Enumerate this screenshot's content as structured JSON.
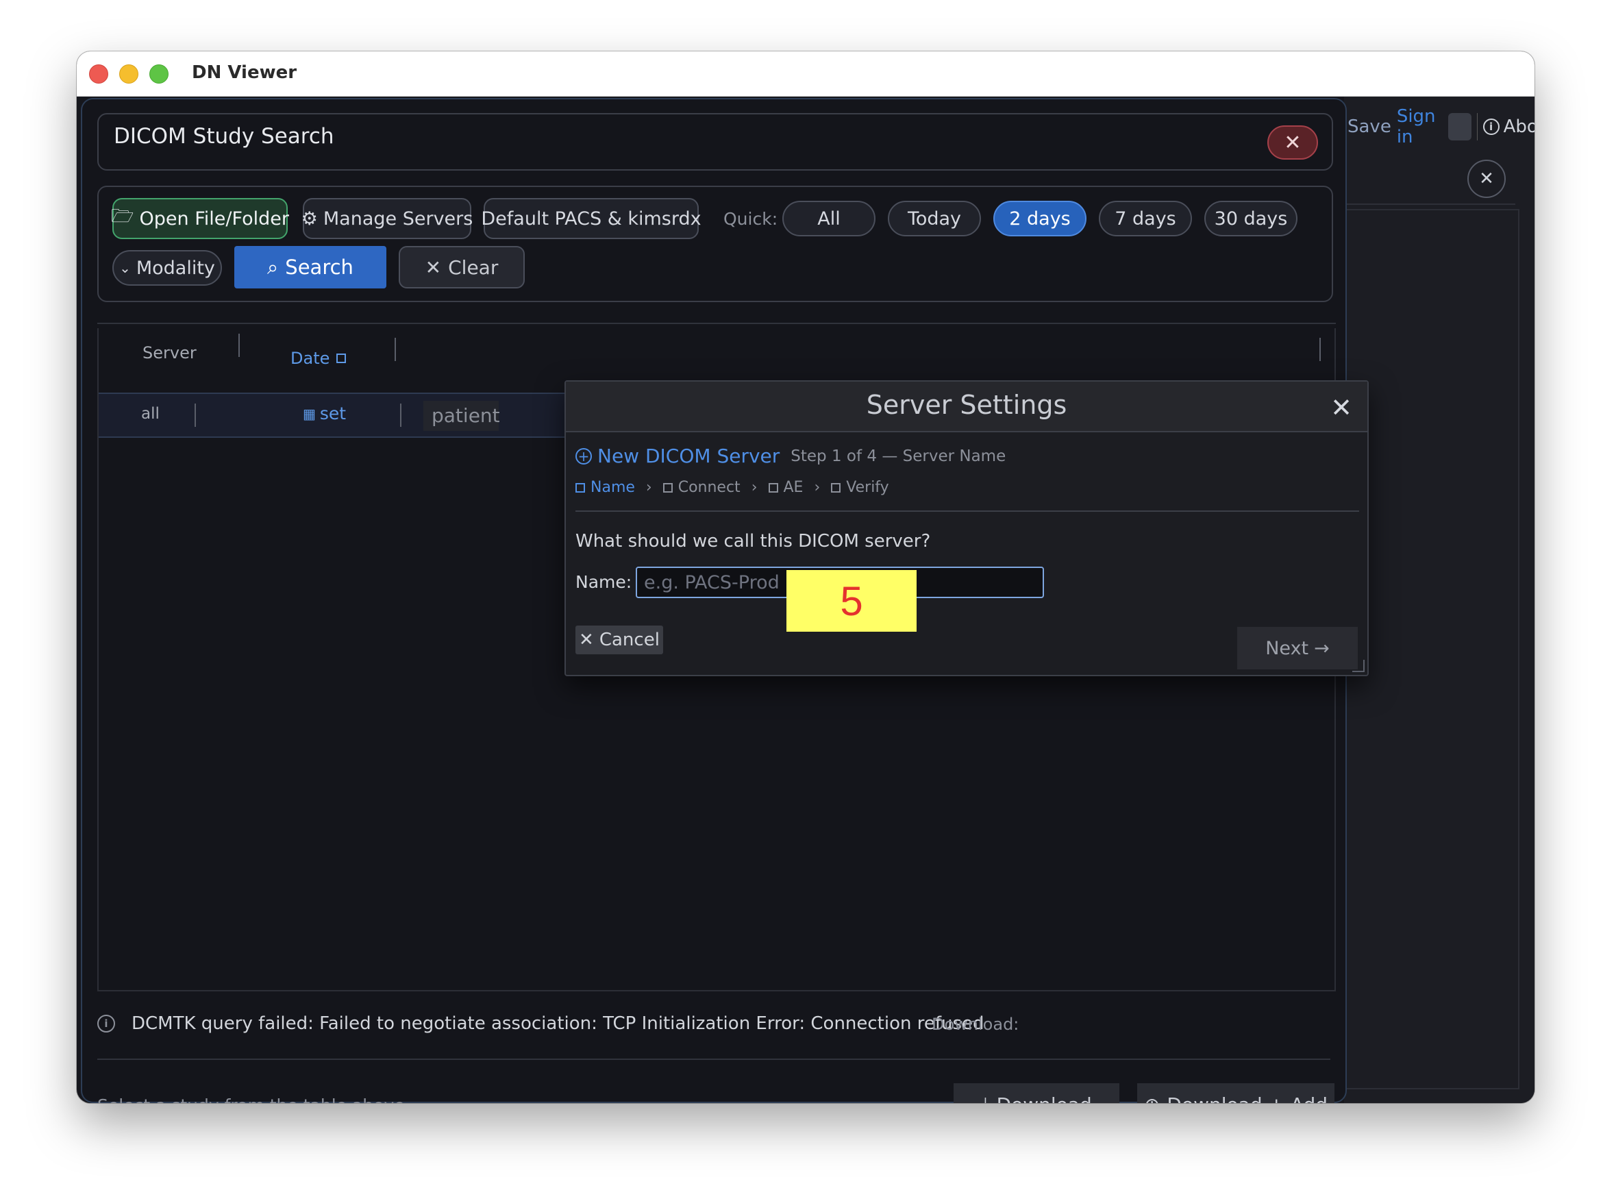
{
  "window": {
    "title": "DN Viewer"
  },
  "background": {
    "save_label": "Save",
    "signin_label": "Sign in",
    "about_label": "About"
  },
  "header": {
    "title": "DICOM Study Search"
  },
  "toolbar": {
    "open_label": "Open File/Folder",
    "manage_label": "Manage Servers",
    "server_selected": "Default PACS & kimsrdx",
    "quick_label": "Quick:",
    "quick_options": [
      "All",
      "Today",
      "2 days",
      "7 days",
      "30 days"
    ],
    "quick_selected": "2 days",
    "modality_label": "Modality",
    "search_label": "Search",
    "clear_label": "Clear"
  },
  "table": {
    "headers": [
      "Server",
      "Date"
    ],
    "filter": {
      "server": "all",
      "date": "set",
      "patient_placeholder": "patient"
    }
  },
  "status": {
    "message": "DCMTK query failed: Failed to negotiate association: TCP Initialization Error: Connection refused",
    "download_label": "Download:"
  },
  "footer": {
    "hint": "Select a study from the table above",
    "download_label": "Download",
    "download_add_label": "Download + Add"
  },
  "modal": {
    "title": "Server Settings",
    "wizard_title": "New DICOM Server",
    "wizard_step": "Step 1 of 4 — Server Name",
    "steps": [
      "Name",
      "Connect",
      "AE",
      "Verify"
    ],
    "active_step": "Name",
    "question": "What should we call this DICOM server?",
    "name_label": "Name:",
    "name_value": "",
    "name_placeholder": "e.g. PACS-Prod",
    "cancel_label": "Cancel",
    "next_label": "Next"
  },
  "annotation": {
    "label": "5"
  },
  "colors": {
    "accent": "#2e67c2",
    "link": "#4f8fe6",
    "badge_bg": "#ffff66",
    "badge_text": "#e4322e"
  }
}
